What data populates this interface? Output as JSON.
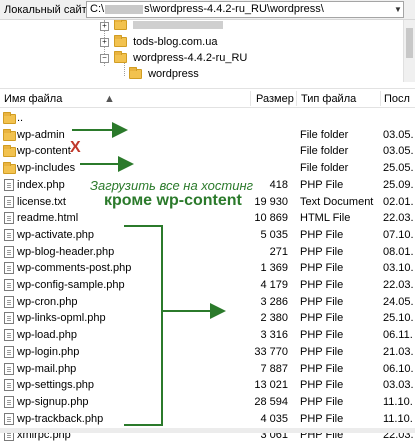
{
  "local_site": {
    "label": "Локальный сайт:",
    "path_prefix": "C:\\",
    "path_suffix": "s\\wordpress-4.4.2-ru_RU\\wordpress\\"
  },
  "tree": {
    "items": [
      {
        "label": "tods-blog.com.ua"
      },
      {
        "label": "wordpress-4.4.2-ru_RU"
      },
      {
        "label": "wordpress"
      }
    ]
  },
  "columns": {
    "name": "Имя файла",
    "size": "Размер",
    "type": "Тип файла",
    "date": "Посл"
  },
  "files": [
    {
      "name": "..",
      "size": "",
      "type": "",
      "date": "",
      "kind": "folder"
    },
    {
      "name": "wp-admin",
      "size": "",
      "type": "File folder",
      "date": "03.05.",
      "kind": "folder"
    },
    {
      "name": "wp-content",
      "size": "",
      "type": "File folder",
      "date": "03.05.",
      "kind": "folder"
    },
    {
      "name": "wp-includes",
      "size": "",
      "type": "File folder",
      "date": "25.05.",
      "kind": "folder"
    },
    {
      "name": "index.php",
      "size": "418",
      "type": "PHP File",
      "date": "25.09.",
      "kind": "file"
    },
    {
      "name": "license.txt",
      "size": "19 930",
      "type": "Text Document",
      "date": "02.01.",
      "kind": "file"
    },
    {
      "name": "readme.html",
      "size": "10 869",
      "type": "HTML File",
      "date": "22.03.",
      "kind": "file"
    },
    {
      "name": "wp-activate.php",
      "size": "5 035",
      "type": "PHP File",
      "date": "07.10.",
      "kind": "file"
    },
    {
      "name": "wp-blog-header.php",
      "size": "271",
      "type": "PHP File",
      "date": "08.01.",
      "kind": "file"
    },
    {
      "name": "wp-comments-post.php",
      "size": "1 369",
      "type": "PHP File",
      "date": "03.10.",
      "kind": "file"
    },
    {
      "name": "wp-config-sample.php",
      "size": "4 179",
      "type": "PHP File",
      "date": "22.03.",
      "kind": "file"
    },
    {
      "name": "wp-cron.php",
      "size": "3 286",
      "type": "PHP File",
      "date": "24.05.",
      "kind": "file"
    },
    {
      "name": "wp-links-opml.php",
      "size": "2 380",
      "type": "PHP File",
      "date": "25.10.",
      "kind": "file"
    },
    {
      "name": "wp-load.php",
      "size": "3 316",
      "type": "PHP File",
      "date": "06.11.",
      "kind": "file"
    },
    {
      "name": "wp-login.php",
      "size": "33 770",
      "type": "PHP File",
      "date": "21.03.",
      "kind": "file"
    },
    {
      "name": "wp-mail.php",
      "size": "7 887",
      "type": "PHP File",
      "date": "06.10.",
      "kind": "file"
    },
    {
      "name": "wp-settings.php",
      "size": "13 021",
      "type": "PHP File",
      "date": "03.03.",
      "kind": "file"
    },
    {
      "name": "wp-signup.php",
      "size": "28 594",
      "type": "PHP File",
      "date": "11.10.",
      "kind": "file"
    },
    {
      "name": "wp-trackback.php",
      "size": "4 035",
      "type": "PHP File",
      "date": "11.10.",
      "kind": "file"
    },
    {
      "name": "xmlrpc.php",
      "size": "3 061",
      "type": "PHP File",
      "date": "22.03.",
      "kind": "file"
    }
  ],
  "annotations": {
    "line1": "Загрузить все на хостинг",
    "line2": "кроме wp-content",
    "excluded_mark": "X"
  },
  "colors": {
    "annotation_green": "#2b7a2b",
    "excluded_red": "#c0392b",
    "folder_yellow": "#f2c24f"
  }
}
